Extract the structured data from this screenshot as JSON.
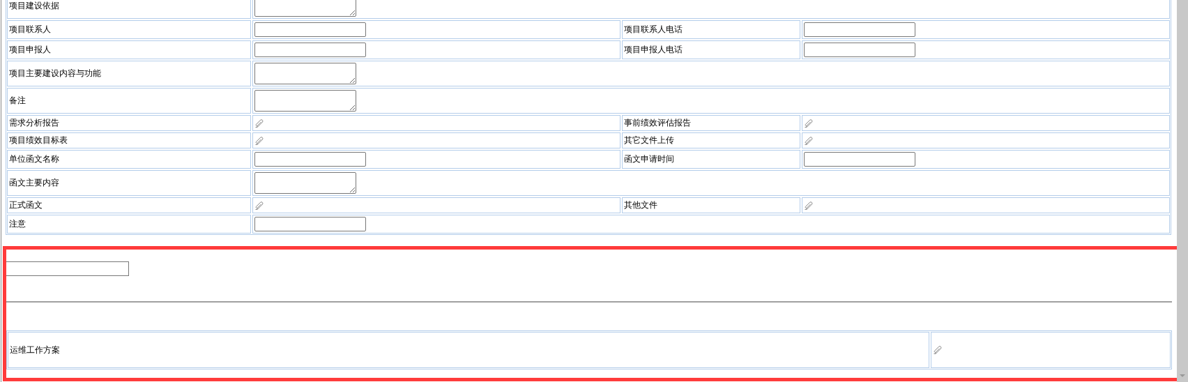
{
  "form": {
    "rows": [
      {
        "cells": [
          {
            "kind": "label",
            "text": "项目建设依据"
          },
          {
            "kind": "textarea"
          }
        ]
      },
      {
        "cells": [
          {
            "kind": "label",
            "text": "项目联系人"
          },
          {
            "kind": "input"
          },
          {
            "kind": "label",
            "text": "项目联系人电话"
          },
          {
            "kind": "input"
          }
        ]
      },
      {
        "cells": [
          {
            "kind": "label",
            "text": "项目申报人"
          },
          {
            "kind": "input"
          },
          {
            "kind": "label",
            "text": "项目申报人电话"
          },
          {
            "kind": "input"
          }
        ]
      },
      {
        "cells": [
          {
            "kind": "label",
            "text": "项目主要建设内容与功能"
          },
          {
            "kind": "textarea"
          }
        ]
      },
      {
        "cells": [
          {
            "kind": "label",
            "text": "备注"
          },
          {
            "kind": "textarea"
          }
        ]
      },
      {
        "cells": [
          {
            "kind": "label",
            "text": "需求分析报告"
          },
          {
            "kind": "attachment"
          },
          {
            "kind": "label",
            "text": "事前绩效评估报告"
          },
          {
            "kind": "attachment"
          }
        ]
      },
      {
        "cells": [
          {
            "kind": "label",
            "text": "项目绩效目标表"
          },
          {
            "kind": "attachment"
          },
          {
            "kind": "label",
            "text": "其它文件上传"
          },
          {
            "kind": "attachment"
          }
        ]
      },
      {
        "cells": [
          {
            "kind": "label",
            "text": "单位函文名称"
          },
          {
            "kind": "input"
          },
          {
            "kind": "label",
            "text": "函文申请时间"
          },
          {
            "kind": "input"
          }
        ]
      },
      {
        "cells": [
          {
            "kind": "label",
            "text": "函文主要内容"
          },
          {
            "kind": "textarea"
          }
        ]
      },
      {
        "cells": [
          {
            "kind": "label",
            "text": "正式函文"
          },
          {
            "kind": "attachment"
          },
          {
            "kind": "label",
            "text": "其他文件"
          },
          {
            "kind": "attachment"
          }
        ]
      },
      {
        "cells": [
          {
            "kind": "label",
            "text": "注意"
          },
          {
            "kind": "input"
          }
        ]
      }
    ]
  },
  "highlighted_section": {
    "rows": [
      {
        "cells": [
          {
            "kind": "label",
            "text": "运维工作方案"
          },
          {
            "kind": "attachment"
          }
        ]
      }
    ]
  }
}
